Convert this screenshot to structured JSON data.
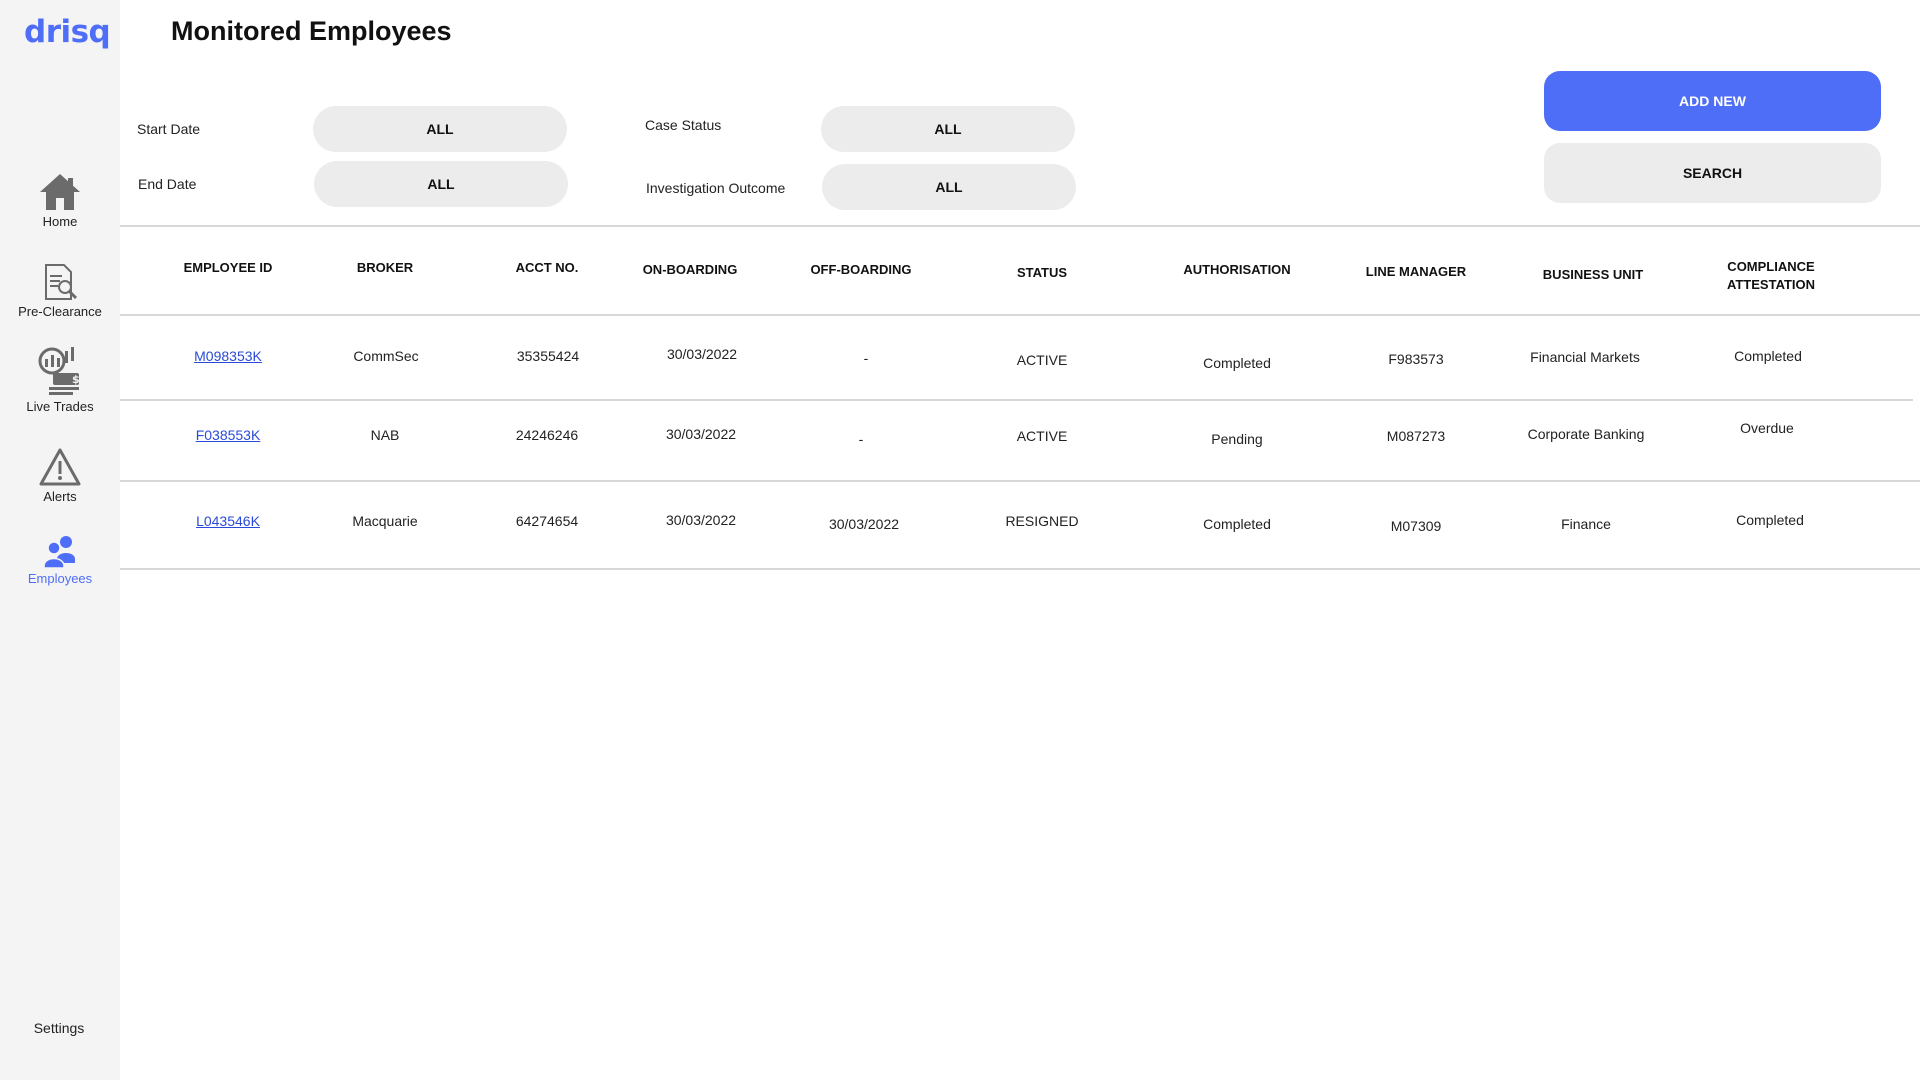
{
  "app": {
    "logo": "drisq",
    "brand_color": "#4f6ef7"
  },
  "sidebar": {
    "items": [
      {
        "label": "Home",
        "icon": "home-icon"
      },
      {
        "label": "Pre-Clearance",
        "icon": "document-search-icon"
      },
      {
        "label": "Live Trades",
        "icon": "live-trades-icon"
      },
      {
        "label": "Alerts",
        "icon": "warning-icon"
      },
      {
        "label": "Employees",
        "icon": "users-icon",
        "active": true
      }
    ],
    "settings": "Settings"
  },
  "page": {
    "title": "Monitored Employees"
  },
  "filters": {
    "start_date": {
      "label": "Start Date",
      "value": "ALL"
    },
    "end_date": {
      "label": "End Date",
      "value": "ALL"
    },
    "case_status": {
      "label": "Case Status",
      "value": "ALL"
    },
    "investigation_outcome": {
      "label": "Investigation Outcome",
      "value": "ALL"
    }
  },
  "actions": {
    "add_new": "ADD NEW",
    "search": "SEARCH"
  },
  "table": {
    "headers": {
      "employee_id": "EMPLOYEE ID",
      "broker": "BROKER",
      "acct_no": "ACCT NO.",
      "on_boarding": "ON-BOARDING",
      "off_boarding": "OFF-BOARDING",
      "status": "STATUS",
      "authorisation": "AUTHORISATION",
      "line_manager": "LINE MANAGER",
      "business_unit": "BUSINESS UNIT",
      "compliance_1": "COMPLIANCE",
      "compliance_2": "ATTESTATION"
    },
    "rows": [
      {
        "employee_id": "M098353K",
        "broker": "CommSec",
        "acct_no": "35355424",
        "on_boarding": "30/03/2022",
        "off_boarding": "-",
        "status": "ACTIVE",
        "authorisation": "Completed",
        "line_manager": "F983573",
        "business_unit": "Financial Markets",
        "compliance": "Completed"
      },
      {
        "employee_id": "F038553K",
        "broker": "NAB",
        "acct_no": "24246246",
        "on_boarding": "30/03/2022",
        "off_boarding": "-",
        "status": "ACTIVE",
        "authorisation": "Pending",
        "line_manager": "M087273",
        "business_unit": "Corporate Banking",
        "compliance": "Overdue"
      },
      {
        "employee_id": "L043546K",
        "broker": "Macquarie",
        "acct_no": "64274654",
        "on_boarding": "30/03/2022",
        "off_boarding": "30/03/2022",
        "status": "RESIGNED",
        "authorisation": "Completed",
        "line_manager": "M07309",
        "business_unit": "Finance",
        "compliance": "Completed"
      }
    ]
  }
}
